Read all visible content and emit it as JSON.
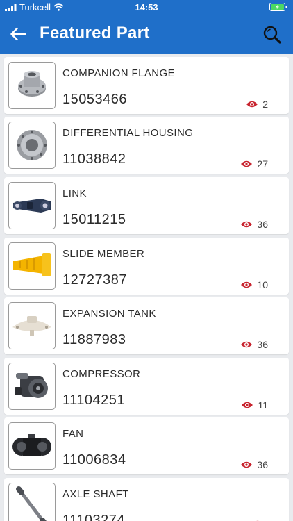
{
  "status_bar": {
    "carrier": "Turkcell",
    "time": "14:53"
  },
  "header": {
    "title": "Featured Part"
  },
  "colors": {
    "header": "#1f6fc9",
    "eye": "#c8242f"
  },
  "parts": [
    {
      "name": "COMPANION FLANGE",
      "number": "15053466",
      "views": "2",
      "icon": "companion-flange-image"
    },
    {
      "name": "DIFFERENTIAL HOUSING",
      "number": "11038842",
      "views": "27",
      "icon": "differential-housing-image"
    },
    {
      "name": "LINK",
      "number": "15011215",
      "views": "36",
      "icon": "link-image"
    },
    {
      "name": "SLIDE MEMBER",
      "number": "12727387",
      "views": "10",
      "icon": "slide-member-image"
    },
    {
      "name": "EXPANSION TANK",
      "number": "11887983",
      "views": "36",
      "icon": "expansion-tank-image"
    },
    {
      "name": "COMPRESSOR",
      "number": "11104251",
      "views": "11",
      "icon": "compressor-image"
    },
    {
      "name": "FAN",
      "number": "11006834",
      "views": "36",
      "icon": "fan-image"
    },
    {
      "name": "AXLE SHAFT",
      "number": "11103274",
      "views": "",
      "icon": "axle-shaft-image"
    }
  ]
}
